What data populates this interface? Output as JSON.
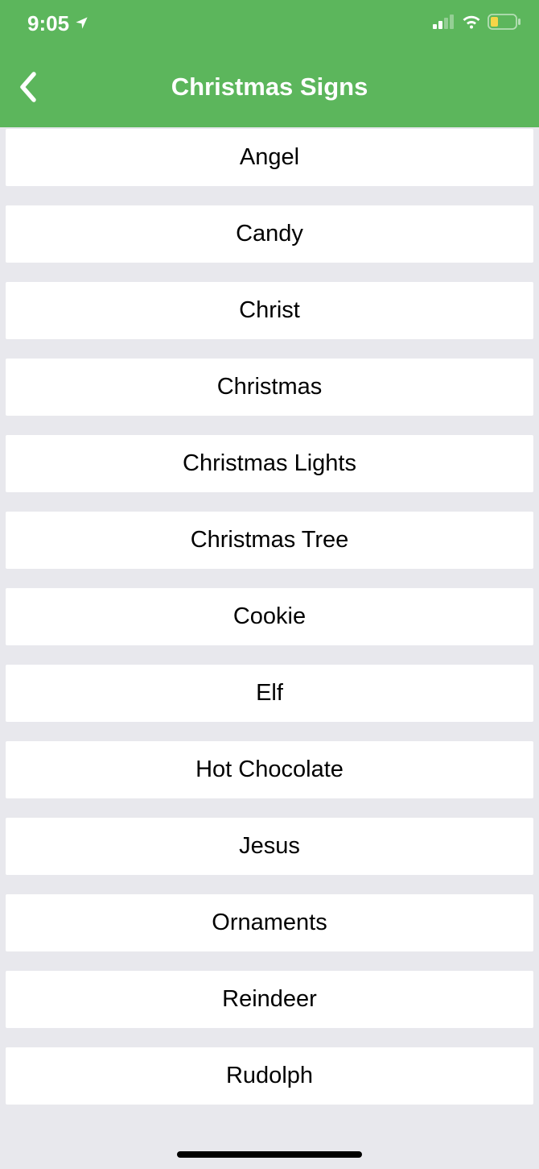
{
  "status": {
    "time": "9:05"
  },
  "header": {
    "title": "Christmas Signs"
  },
  "items": [
    {
      "label": "Angel"
    },
    {
      "label": "Candy"
    },
    {
      "label": "Christ"
    },
    {
      "label": "Christmas"
    },
    {
      "label": "Christmas Lights"
    },
    {
      "label": "Christmas Tree"
    },
    {
      "label": "Cookie"
    },
    {
      "label": "Elf"
    },
    {
      "label": "Hot Chocolate"
    },
    {
      "label": "Jesus"
    },
    {
      "label": "Ornaments"
    },
    {
      "label": "Reindeer"
    },
    {
      "label": "Rudolph"
    }
  ]
}
